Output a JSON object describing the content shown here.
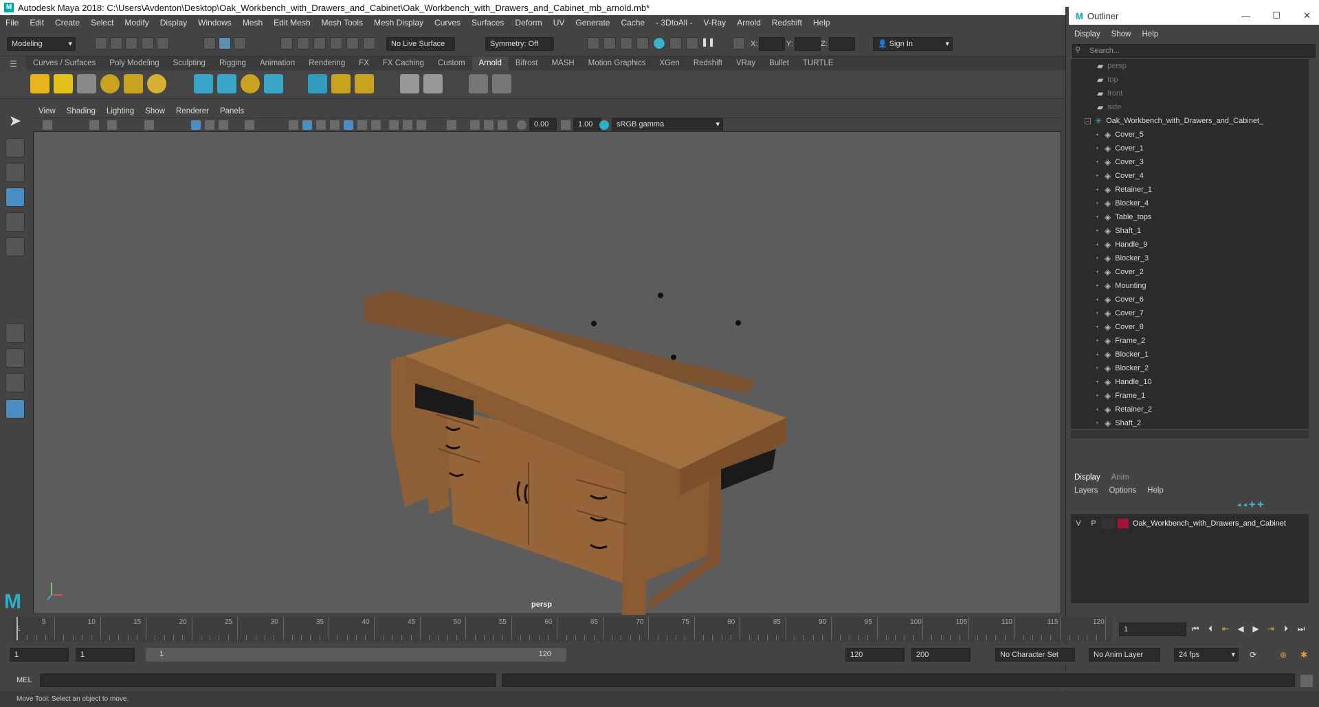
{
  "window": {
    "title": "Autodesk Maya 2018: C:\\Users\\Avdenton\\Desktop\\Oak_Workbench_with_Drawers_and_Cabinet\\Oak_Workbench_with_Drawers_and_Cabinet_mb_arnold.mb*"
  },
  "menubar": [
    "File",
    "Edit",
    "Create",
    "Select",
    "Modify",
    "Display",
    "Windows",
    "Mesh",
    "Edit Mesh",
    "Mesh Tools",
    "Mesh Display",
    "Curves",
    "Surfaces",
    "Deform",
    "UV",
    "Generate",
    "Cache",
    "- 3DtoAll -",
    "V-Ray",
    "Arnold",
    "Redshift",
    "Help"
  ],
  "toolbar": {
    "mode": "Modeling",
    "live_surface": "No Live Surface",
    "symmetry": "Symmetry: Off",
    "x_label": "X:",
    "y_label": "Y:",
    "z_label": "Z:",
    "sign_in": "Sign In"
  },
  "shelf_tabs": [
    "Curves / Surfaces",
    "Poly Modeling",
    "Sculpting",
    "Rigging",
    "Animation",
    "Rendering",
    "FX",
    "FX Caching",
    "Custom",
    "Arnold",
    "Bifrost",
    "MASH",
    "Motion Graphics",
    "XGen",
    "Redshift",
    "VRay",
    "Bullet",
    "TURTLE"
  ],
  "shelf_active": "Arnold",
  "viewport": {
    "menu": [
      "View",
      "Shading",
      "Lighting",
      "Show",
      "Renderer",
      "Panels"
    ],
    "exposure": "0.00",
    "gamma": "1.00",
    "color_space": "sRGB gamma",
    "camera_label": "persp"
  },
  "outliner": {
    "title": "Outliner",
    "menu": [
      "Display",
      "Show",
      "Help"
    ],
    "search_placeholder": "Search...",
    "cameras": [
      "persp",
      "top",
      "front",
      "side"
    ],
    "root": "Oak_Workbench_with_Drawers_and_Cabinet_",
    "children": [
      "Cover_5",
      "Cover_1",
      "Cover_3",
      "Cover_4",
      "Retainer_1",
      "Blocker_4",
      "Table_tops",
      "Shaft_1",
      "Handle_9",
      "Blocker_3",
      "Cover_2",
      "Mounting",
      "Cover_6",
      "Cover_7",
      "Cover_8",
      "Frame_2",
      "Blocker_1",
      "Blocker_2",
      "Handle_10",
      "Frame_1",
      "Retainer_2",
      "Shaft_2"
    ]
  },
  "layer_editor": {
    "tabs": [
      "Display",
      "Anim"
    ],
    "menu": [
      "Layers",
      "Options",
      "Help"
    ],
    "layer": {
      "v": "V",
      "p": "P",
      "name": "Oak_Workbench_with_Drawers_and_Cabinet",
      "color": "#a3133a"
    }
  },
  "timeline": {
    "ticks": [
      5,
      10,
      15,
      20,
      25,
      30,
      35,
      40,
      45,
      50,
      55,
      60,
      65,
      70,
      75,
      80,
      85,
      90,
      95,
      100,
      105,
      110,
      115,
      120
    ],
    "start_label": "1",
    "current_frame": "1"
  },
  "range": {
    "start": "1",
    "anim_start": "1",
    "range_start": "1",
    "range_end": "120",
    "end": "120",
    "anim_end": "200",
    "character_set": "No Character Set",
    "anim_layer": "No Anim Layer",
    "fps": "24 fps"
  },
  "command": {
    "lang": "MEL"
  },
  "help_line": "Move Tool: Select an object to move."
}
